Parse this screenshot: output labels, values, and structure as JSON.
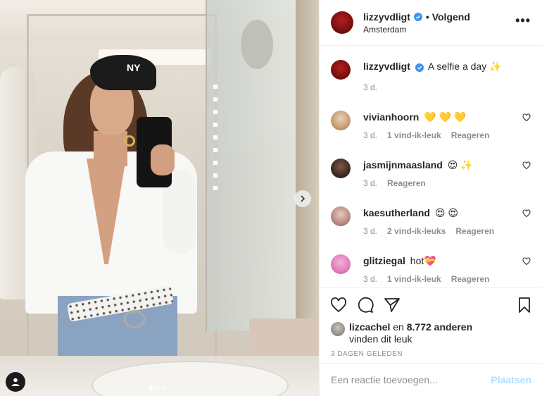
{
  "post": {
    "username": "lizzyvdligt",
    "follow_label": "• Volgend",
    "location": "Amsterdam",
    "more_label": "•••",
    "caption": "A selfie a day ✨",
    "caption_time": "3 d.",
    "cap_logo": "NY"
  },
  "comments": [
    {
      "user": "vivianhoorn",
      "text": "💛 💛 💛",
      "time": "3 d.",
      "likes": "1 vind-ik-leuk",
      "reply": "Reageren"
    },
    {
      "user": "jasmijnmaasland",
      "text": "😍 ✨",
      "time": "3 d.",
      "likes": "",
      "reply": "Reageren"
    },
    {
      "user": "kaesutherland",
      "text": "😍 😍",
      "time": "3 d.",
      "likes": "2 vind-ik-leuks",
      "reply": "Reageren"
    },
    {
      "user": "glitziegal",
      "text": "hot💝",
      "time": "3 d.",
      "likes": "1 vind-ik-leuk",
      "reply": "Reageren"
    }
  ],
  "likes": {
    "user": "lizcachel",
    "and": "en",
    "others": "8.772 anderen",
    "suffix": "vinden dit leuk"
  },
  "date": "3 DAGEN GELEDEN",
  "add_comment": {
    "placeholder": "Een reactie toevoegen...",
    "post_label": "Plaatsen"
  },
  "carousel": {
    "count": 3,
    "active": 1
  },
  "icons": {
    "heart": "heart-icon",
    "comment": "comment-icon",
    "share": "share-icon",
    "bookmark": "bookmark-icon",
    "next": "chevron-right-icon",
    "tag": "user-tag-icon",
    "verified": "verified-icon"
  },
  "colors": {
    "verified": "#3897f0",
    "post_disabled": "#b2dffc",
    "muted": "#8e8e8e"
  }
}
